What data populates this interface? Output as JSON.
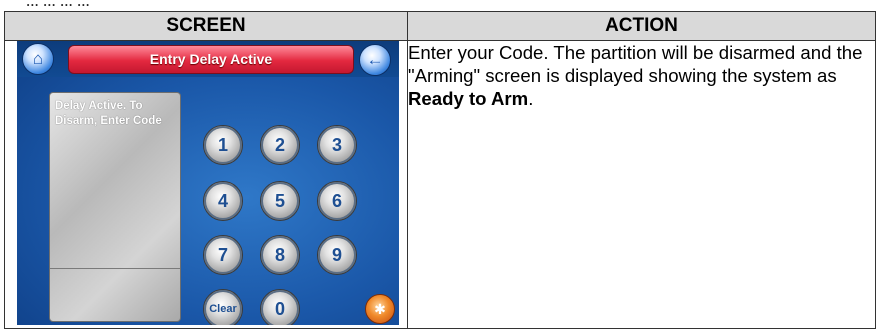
{
  "cut_line_text": "... ... ... ...",
  "table": {
    "header_screen": "SCREEN",
    "header_action": "ACTION"
  },
  "screen": {
    "title": "Entry Delay Active",
    "home_icon": "home-icon",
    "back_icon": "back-arrow-icon",
    "display_text": "Delay Active. To Disarm, Enter Code",
    "keys": [
      "1",
      "2",
      "3",
      "4",
      "5",
      "6",
      "7",
      "8",
      "9",
      "Clear",
      "0"
    ],
    "emergency_icon": "emergency-icon",
    "colors": {
      "background": "#1a57a8",
      "title_bar": "#e3283f",
      "emergency": "#f08a2a"
    }
  },
  "action": {
    "text_before": "Enter your Code. The partition will be disarmed and the \"Arming\" screen is displayed showing the system as ",
    "text_bold": "Ready to Arm",
    "text_after": "."
  }
}
